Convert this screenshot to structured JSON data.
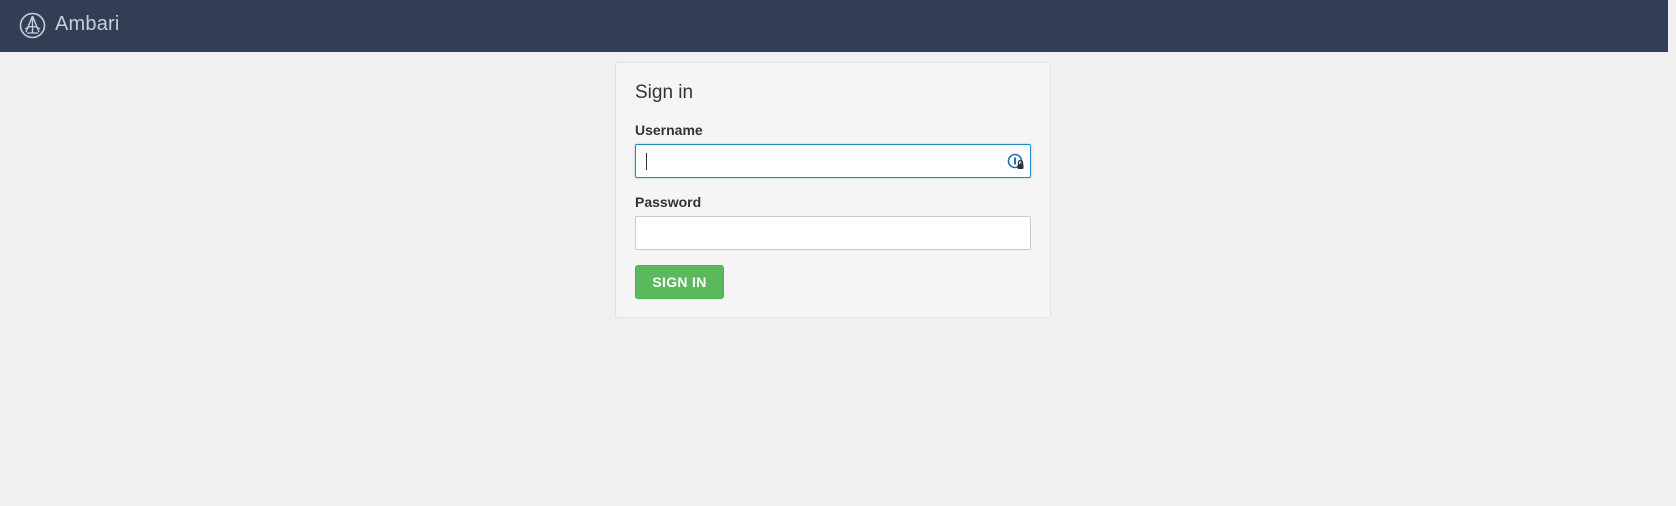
{
  "header": {
    "brand": "Ambari",
    "logo_icon": "ambari-logo-icon",
    "background": "#323e55"
  },
  "signin": {
    "title": "Sign in",
    "username_label": "Username",
    "username_value": "",
    "password_label": "Password",
    "password_value": "",
    "button_label": "SIGN IN",
    "button_color": "#5cb85c",
    "password_manager_icon": "password-manager-icon"
  }
}
